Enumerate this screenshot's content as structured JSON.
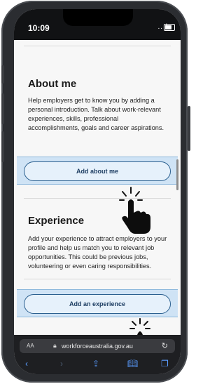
{
  "status": {
    "time": "10:09",
    "signal": "..ıl"
  },
  "about": {
    "title": "About me",
    "text": "Help employers get to know you by adding a personal introduction. Talk about work-relevant experiences, skills, professional accomplishments, goals and career aspirations.",
    "button": "Add about me"
  },
  "experience": {
    "title": "Experience",
    "text": "Add your experience to attract employers to your profile and help us match you to relevant job opportunities. This could be previous jobs, volunteering or even caring responsibilities.",
    "button": "Add an experience"
  },
  "browser": {
    "aa": "AA",
    "url": "workforceaustralia.gov.au",
    "icons": [
      "back-icon",
      "forward-icon",
      "share-icon",
      "bookmarks-icon",
      "tabs-icon"
    ]
  },
  "colors": {
    "button_bar": "#cfe3f5",
    "button_border": "#2a5f8f",
    "browser_accent": "#5a9cff"
  }
}
